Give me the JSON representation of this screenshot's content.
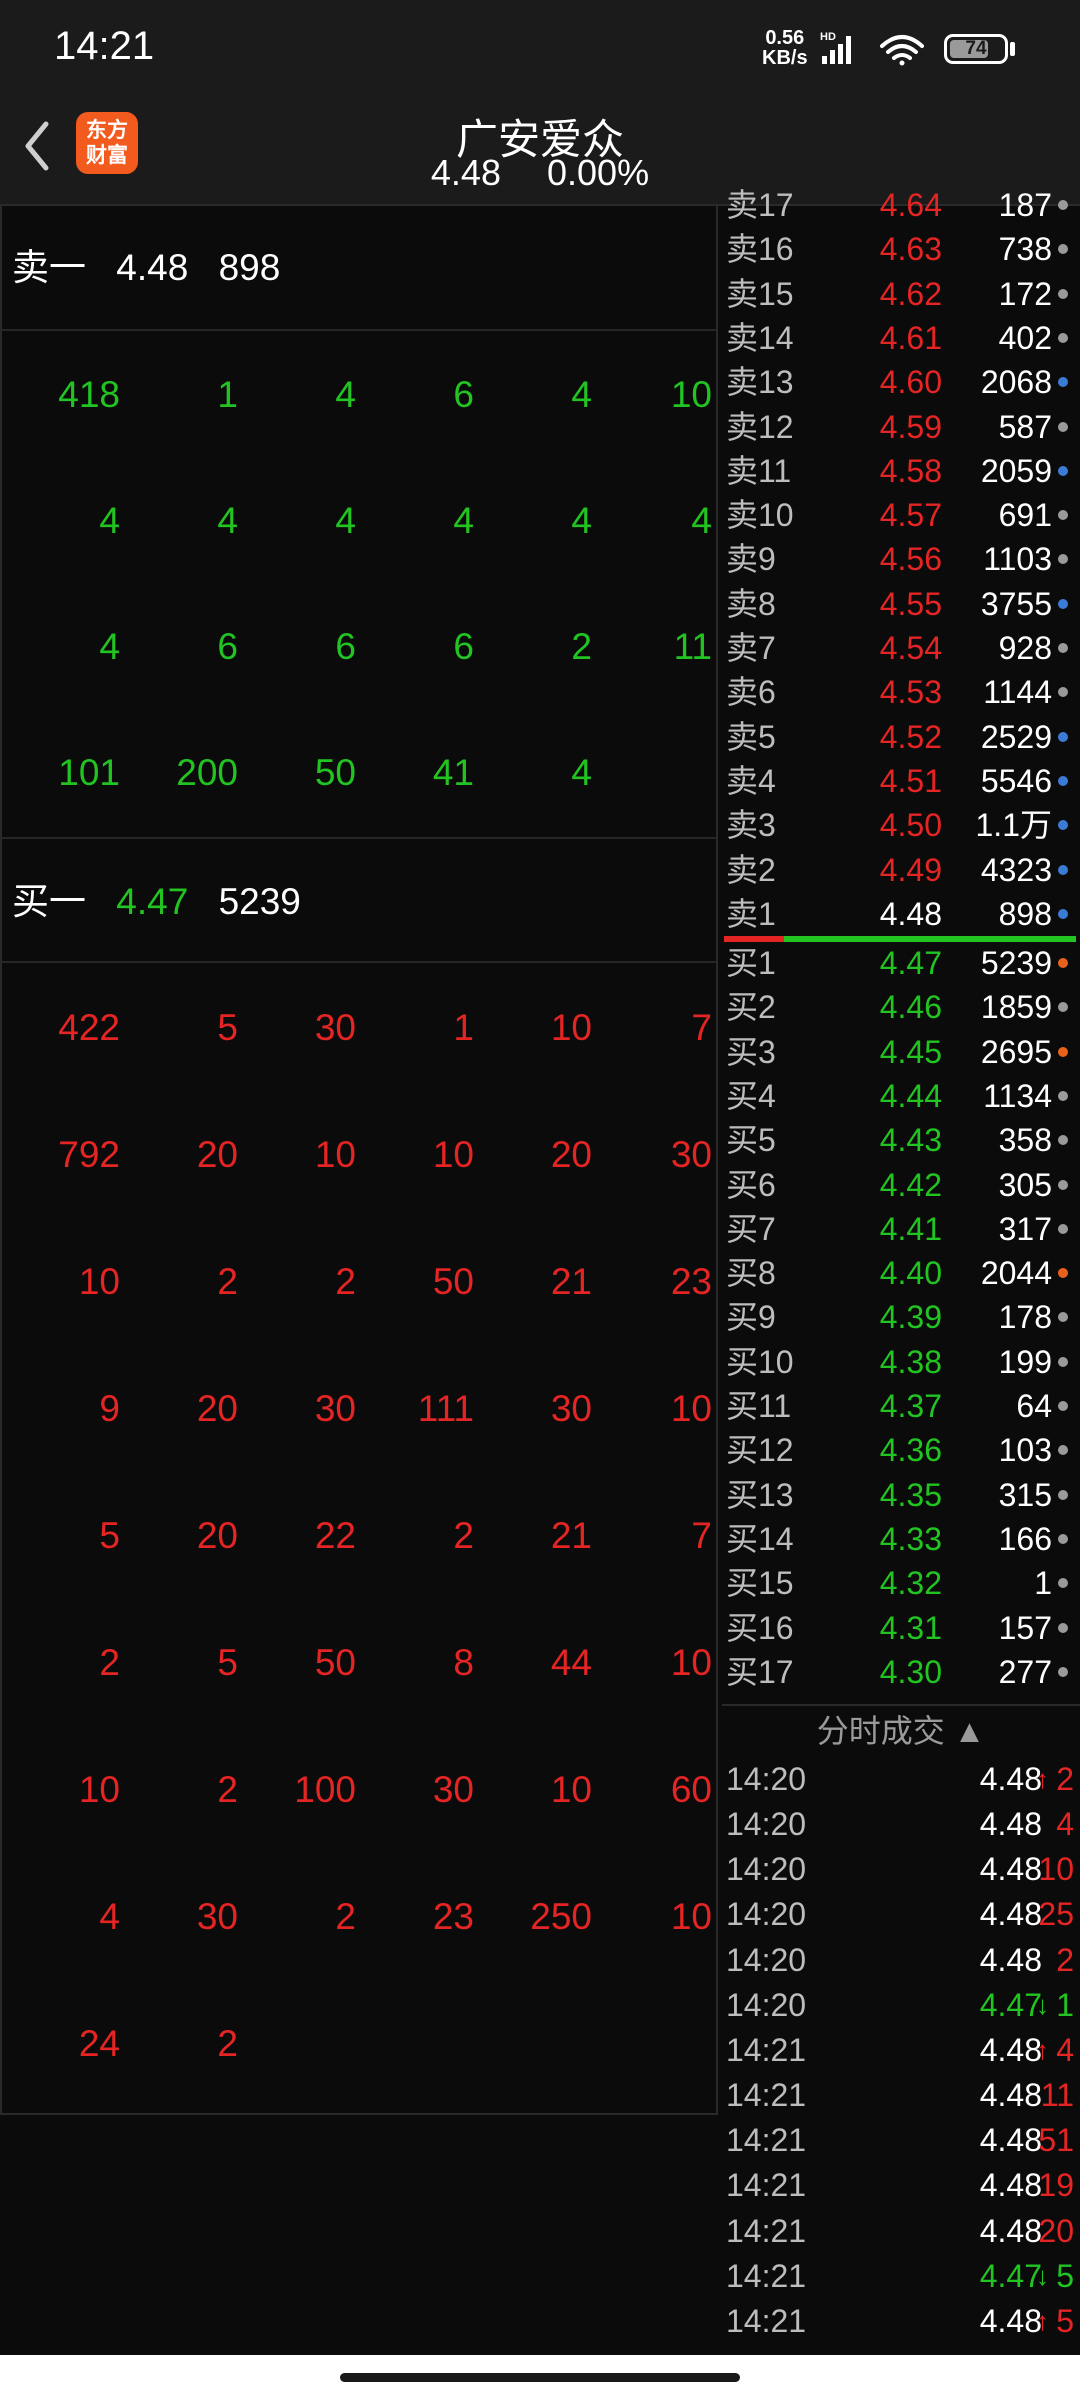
{
  "status_bar": {
    "time": "14:21",
    "net_speed": "0.56",
    "net_unit": "KB/s",
    "battery": "74",
    "battery_level": 0.74
  },
  "header": {
    "logo_line1": "东方",
    "logo_line2": "财富",
    "stock_name": "广安爱众",
    "price": "4.48",
    "change_pct": "0.00%"
  },
  "ask1": {
    "label": "卖一",
    "price": "4.48",
    "volume": "898"
  },
  "ask_queue": [
    [
      "418",
      "1",
      "4",
      "6",
      "4",
      "10"
    ],
    [
      "4",
      "4",
      "4",
      "4",
      "4",
      "4"
    ],
    [
      "4",
      "6",
      "6",
      "6",
      "2",
      "11"
    ],
    [
      "101",
      "200",
      "50",
      "41",
      "4"
    ]
  ],
  "bid1": {
    "label": "买一",
    "price": "4.47",
    "volume": "5239"
  },
  "bid_queue": [
    [
      "422",
      "5",
      "30",
      "1",
      "10",
      "7"
    ],
    [
      "792",
      "20",
      "10",
      "10",
      "20",
      "30"
    ],
    [
      "10",
      "2",
      "2",
      "50",
      "21",
      "23"
    ],
    [
      "9",
      "20",
      "30",
      "111",
      "30",
      "10"
    ],
    [
      "5",
      "20",
      "22",
      "2",
      "21",
      "7"
    ],
    [
      "2",
      "5",
      "50",
      "8",
      "44",
      "10"
    ],
    [
      "10",
      "2",
      "100",
      "30",
      "10",
      "60"
    ],
    [
      "4",
      "30",
      "2",
      "23",
      "250",
      "10"
    ],
    [
      "24",
      "2"
    ]
  ],
  "asks": [
    {
      "label": "卖17",
      "price": "4.64",
      "vol": "187",
      "dot": "gray"
    },
    {
      "label": "卖16",
      "price": "4.63",
      "vol": "738",
      "dot": "gray"
    },
    {
      "label": "卖15",
      "price": "4.62",
      "vol": "172",
      "dot": "gray"
    },
    {
      "label": "卖14",
      "price": "4.61",
      "vol": "402",
      "dot": "gray"
    },
    {
      "label": "卖13",
      "price": "4.60",
      "vol": "2068",
      "dot": "blue"
    },
    {
      "label": "卖12",
      "price": "4.59",
      "vol": "587",
      "dot": "gray"
    },
    {
      "label": "卖11",
      "price": "4.58",
      "vol": "2059",
      "dot": "blue"
    },
    {
      "label": "卖10",
      "price": "4.57",
      "vol": "691",
      "dot": "gray"
    },
    {
      "label": "卖9",
      "price": "4.56",
      "vol": "1103",
      "dot": "gray"
    },
    {
      "label": "卖8",
      "price": "4.55",
      "vol": "3755",
      "dot": "blue"
    },
    {
      "label": "卖7",
      "price": "4.54",
      "vol": "928",
      "dot": "gray"
    },
    {
      "label": "卖6",
      "price": "4.53",
      "vol": "1144",
      "dot": "gray"
    },
    {
      "label": "卖5",
      "price": "4.52",
      "vol": "2529",
      "dot": "blue"
    },
    {
      "label": "卖4",
      "price": "4.51",
      "vol": "5546",
      "dot": "blue"
    },
    {
      "label": "卖3",
      "price": "4.50",
      "vol": "1.1万",
      "dot": "blue"
    },
    {
      "label": "卖2",
      "price": "4.49",
      "vol": "4323",
      "dot": "blue"
    },
    {
      "label": "卖1",
      "price": "4.48",
      "vol": "898",
      "dot": "blue"
    }
  ],
  "bids": [
    {
      "label": "买1",
      "price": "4.47",
      "vol": "5239",
      "dot": "orange"
    },
    {
      "label": "买2",
      "price": "4.46",
      "vol": "1859",
      "dot": "gray"
    },
    {
      "label": "买3",
      "price": "4.45",
      "vol": "2695",
      "dot": "orange"
    },
    {
      "label": "买4",
      "price": "4.44",
      "vol": "1134",
      "dot": "gray"
    },
    {
      "label": "买5",
      "price": "4.43",
      "vol": "358",
      "dot": "gray"
    },
    {
      "label": "买6",
      "price": "4.42",
      "vol": "305",
      "dot": "gray"
    },
    {
      "label": "买7",
      "price": "4.41",
      "vol": "317",
      "dot": "gray"
    },
    {
      "label": "买8",
      "price": "4.40",
      "vol": "2044",
      "dot": "orange"
    },
    {
      "label": "买9",
      "price": "4.39",
      "vol": "178",
      "dot": "gray"
    },
    {
      "label": "买10",
      "price": "4.38",
      "vol": "199",
      "dot": "gray"
    },
    {
      "label": "买11",
      "price": "4.37",
      "vol": "64",
      "dot": "gray"
    },
    {
      "label": "买12",
      "price": "4.36",
      "vol": "103",
      "dot": "gray"
    },
    {
      "label": "买13",
      "price": "4.35",
      "vol": "315",
      "dot": "gray"
    },
    {
      "label": "买14",
      "price": "4.33",
      "vol": "166",
      "dot": "gray"
    },
    {
      "label": "买15",
      "price": "4.32",
      "vol": "1",
      "dot": "gray"
    },
    {
      "label": "买16",
      "price": "4.31",
      "vol": "157",
      "dot": "gray"
    },
    {
      "label": "买17",
      "price": "4.30",
      "vol": "277",
      "dot": "gray"
    }
  ],
  "ticks_title": "分时成交 ▲",
  "ticks": [
    {
      "time": "14:20",
      "price": "4.48",
      "arrow": "up",
      "vol": "2",
      "color": "white",
      "vol_color": "red"
    },
    {
      "time": "14:20",
      "price": "4.48",
      "arrow": "",
      "vol": "4",
      "color": "white",
      "vol_color": "red"
    },
    {
      "time": "14:20",
      "price": "4.48",
      "arrow": "",
      "vol": "10",
      "color": "white",
      "vol_color": "red"
    },
    {
      "time": "14:20",
      "price": "4.48",
      "arrow": "",
      "vol": "25",
      "color": "white",
      "vol_color": "red"
    },
    {
      "time": "14:20",
      "price": "4.48",
      "arrow": "",
      "vol": "2",
      "color": "white",
      "vol_color": "red"
    },
    {
      "time": "14:20",
      "price": "4.47",
      "arrow": "down",
      "vol": "1",
      "color": "green",
      "vol_color": "green"
    },
    {
      "time": "14:21",
      "price": "4.48",
      "arrow": "up",
      "vol": "4",
      "color": "white",
      "vol_color": "red"
    },
    {
      "time": "14:21",
      "price": "4.48",
      "arrow": "",
      "vol": "11",
      "color": "white",
      "vol_color": "red"
    },
    {
      "time": "14:21",
      "price": "4.48",
      "arrow": "",
      "vol": "51",
      "color": "white",
      "vol_color": "red"
    },
    {
      "time": "14:21",
      "price": "4.48",
      "arrow": "",
      "vol": "19",
      "color": "white",
      "vol_color": "red"
    },
    {
      "time": "14:21",
      "price": "4.48",
      "arrow": "",
      "vol": "20",
      "color": "white",
      "vol_color": "red"
    },
    {
      "time": "14:21",
      "price": "4.47",
      "arrow": "down",
      "vol": "5",
      "color": "green",
      "vol_color": "green"
    },
    {
      "time": "14:21",
      "price": "4.48",
      "arrow": "up",
      "vol": "5",
      "color": "white",
      "vol_color": "red"
    }
  ],
  "colors": {
    "red": "#e52424",
    "green": "#22c422",
    "blue": "#3a7bd5",
    "orange": "#e8621c",
    "gray": "#9a9a9a"
  }
}
